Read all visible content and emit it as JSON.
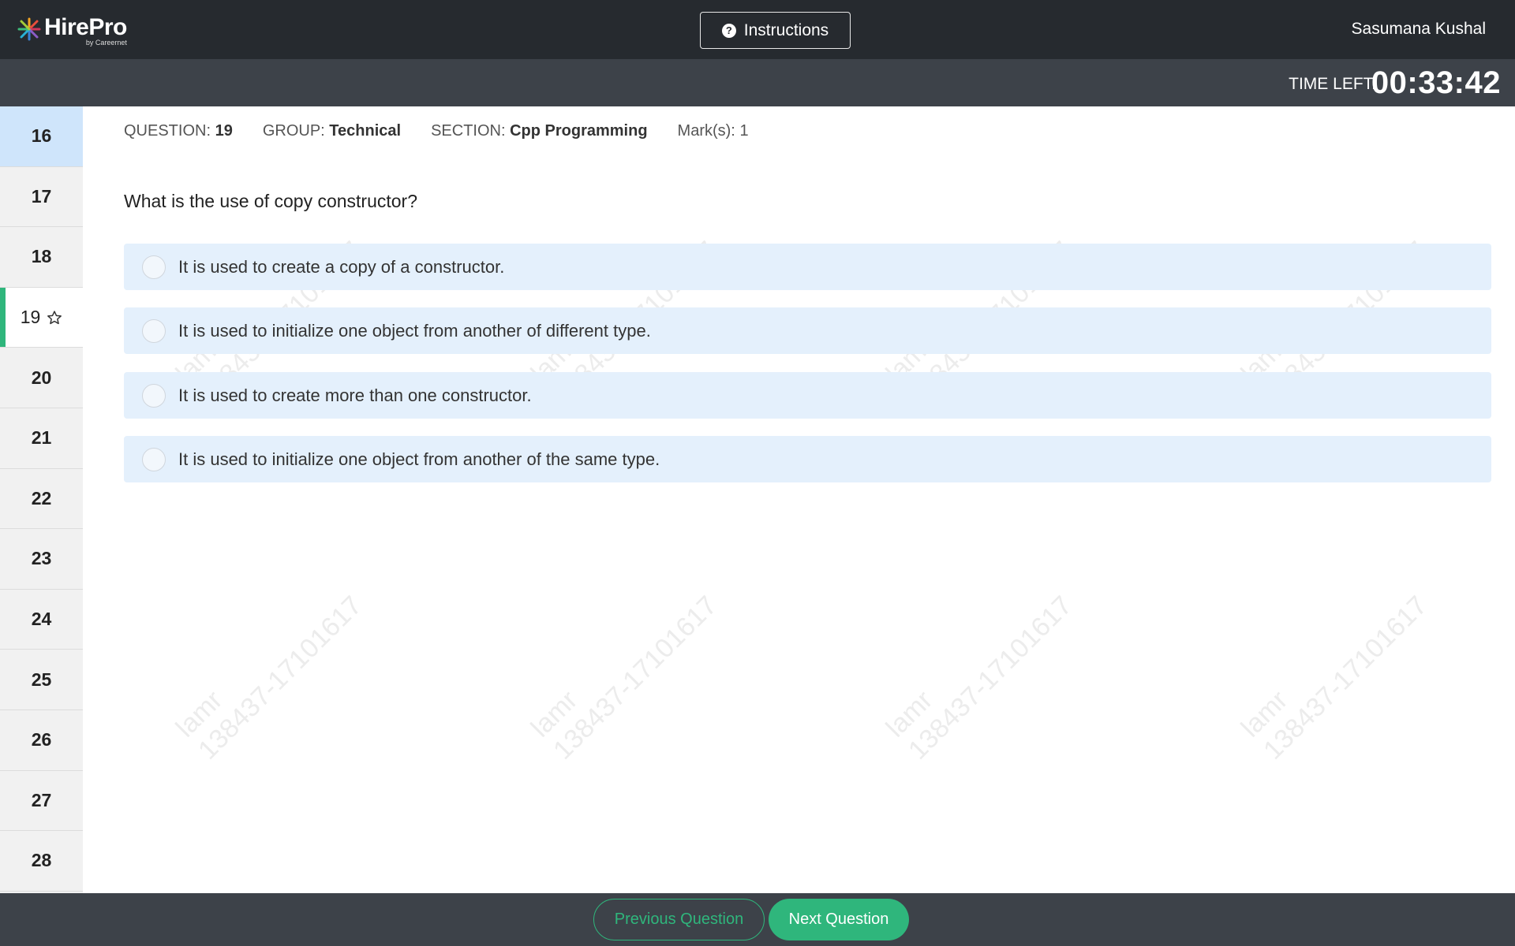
{
  "header": {
    "logo_name": "HirePro",
    "logo_sub": "by Careernet",
    "instructions_label": "Instructions",
    "user_name": "Sasumana Kushal"
  },
  "timer": {
    "label": "TIME LEFT:",
    "value": "00:33:42"
  },
  "sidebar": {
    "items": [
      "16",
      "17",
      "18",
      "19",
      "20",
      "21",
      "22",
      "23",
      "24",
      "25",
      "26",
      "27",
      "28"
    ],
    "current": "19",
    "highlighted": "16"
  },
  "meta": {
    "question_label": "QUESTION:",
    "question_value": "19",
    "group_label": "GROUP:",
    "group_value": "Technical",
    "section_label": "SECTION:",
    "section_value": "Cpp Programming",
    "marks_label": "Mark(s):",
    "marks_value": "1"
  },
  "question": {
    "text": "What is the use of copy constructor?",
    "options": [
      "It is used to create a copy of a constructor.",
      "It is used to initialize one object from another of different type.",
      "It is used to create more than one constructor.",
      "It is used to initialize one object from another of the same type."
    ]
  },
  "watermark": {
    "line1": "lamr",
    "line2": "138437-17101617"
  },
  "footer": {
    "prev_label": "Previous Question",
    "next_label": "Next Question"
  },
  "colors": {
    "accent": "#2fb67c",
    "header": "#262a2f",
    "bar": "#3d4249",
    "option_bg": "#e4f0fc",
    "sidebar_highlight": "#cfe5fb"
  }
}
